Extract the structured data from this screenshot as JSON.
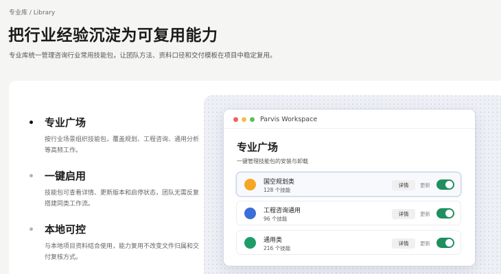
{
  "header": {
    "eyebrow": "专业库 / Library",
    "title": "把行业经验沉淀为可复用能力",
    "subtitle": "专业库统一管理咨询行业常用技能包，让团队方法、资料口径和交付模板在项目中稳定复用。"
  },
  "features": [
    {
      "title": "专业广场",
      "desc": "按行业场景组织技能包，覆盖规划、工程咨询、通用分析等高频工作。",
      "active": true
    },
    {
      "title": "一键启用",
      "desc": "技能包可查看详情、更新版本和启停状态，团队无需反复搭建同类工作流。",
      "active": false
    },
    {
      "title": "本地可控",
      "desc": "与本地项目资料结合使用，能力复用不改变文件归属和交付复核方式。",
      "active": false
    }
  ],
  "window": {
    "title": "Parvis Workspace",
    "controls": {
      "close_color": "#f0605a",
      "minimize_color": "#f5bd4f",
      "zoom_color": "#5bc25a"
    },
    "heading": "专业广场",
    "subheading": "一键管理技能包的安装与卸载",
    "cards": [
      {
        "name": "国空规划类",
        "count": "128 个技能",
        "color": "#f5a623",
        "detail_label": "详情",
        "update_label": "更新",
        "enabled": true,
        "selected": true
      },
      {
        "name": "工程咨询通用",
        "count": "96 个技能",
        "color": "#3b6fd8",
        "detail_label": "详情",
        "update_label": "更新",
        "enabled": true,
        "selected": false
      },
      {
        "name": "通用类",
        "count": "216 个技能",
        "color": "#1e9d68",
        "detail_label": "详情",
        "update_label": "更新",
        "enabled": true,
        "selected": false
      }
    ]
  }
}
